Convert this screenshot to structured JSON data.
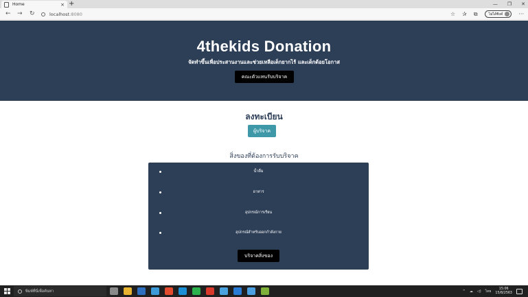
{
  "browser": {
    "tab_title": "Home",
    "tab_close": "×",
    "new_tab": "+",
    "window_controls": [
      "—",
      "❐",
      "✕"
    ],
    "nav": {
      "back": "←",
      "forward": "→",
      "refresh": "↻"
    },
    "address_host": "localhost",
    "address_port": ":8080",
    "profile_label": "ไม่ได้ซิงค์",
    "more_menu": "···",
    "icons": [
      "star-icon",
      "favorites-icon",
      "collections-icon"
    ]
  },
  "hero": {
    "title": "4thekids Donation",
    "subtitle": "จัดทำขึ้นเพื่อประสานงานและช่วยเหลือเด็กยากไร้ และเด็กด้อยโอกาส",
    "button_label": "คณะตัวแทนรับบริจาค"
  },
  "register": {
    "title": "ลงทะเบียน",
    "button_label": "ผู้บริจาค"
  },
  "needs": {
    "title": "สิ่งของที่ต้องการรับบริจาค",
    "items": [
      "น้ำดื่ม",
      "อาหาร",
      "อุปกรณ์การเรียน",
      "อุปกรณ์สำหรับออกกำลังกาย"
    ],
    "button_label": "บริจาคสิ่งของ"
  },
  "taskbar": {
    "search_placeholder": "พิมพ์ที่นี่เพื่อค้นหา",
    "language": "ไทย",
    "time": "15:06",
    "date": "15/8/2563",
    "app_colors": [
      "#8a8a8a",
      "#e8b331",
      "#2f6fbf",
      "#3c9ad8",
      "#e24b2d",
      "#1a8fd6",
      "#2bb24c",
      "#d8392b",
      "#4aa3df",
      "#2a7bd6",
      "#4c9fe0",
      "#7fb13a"
    ]
  },
  "colors": {
    "hero_bg": "#2d3e57",
    "register_button": "#3f98a8",
    "dark_button": "#000000"
  }
}
